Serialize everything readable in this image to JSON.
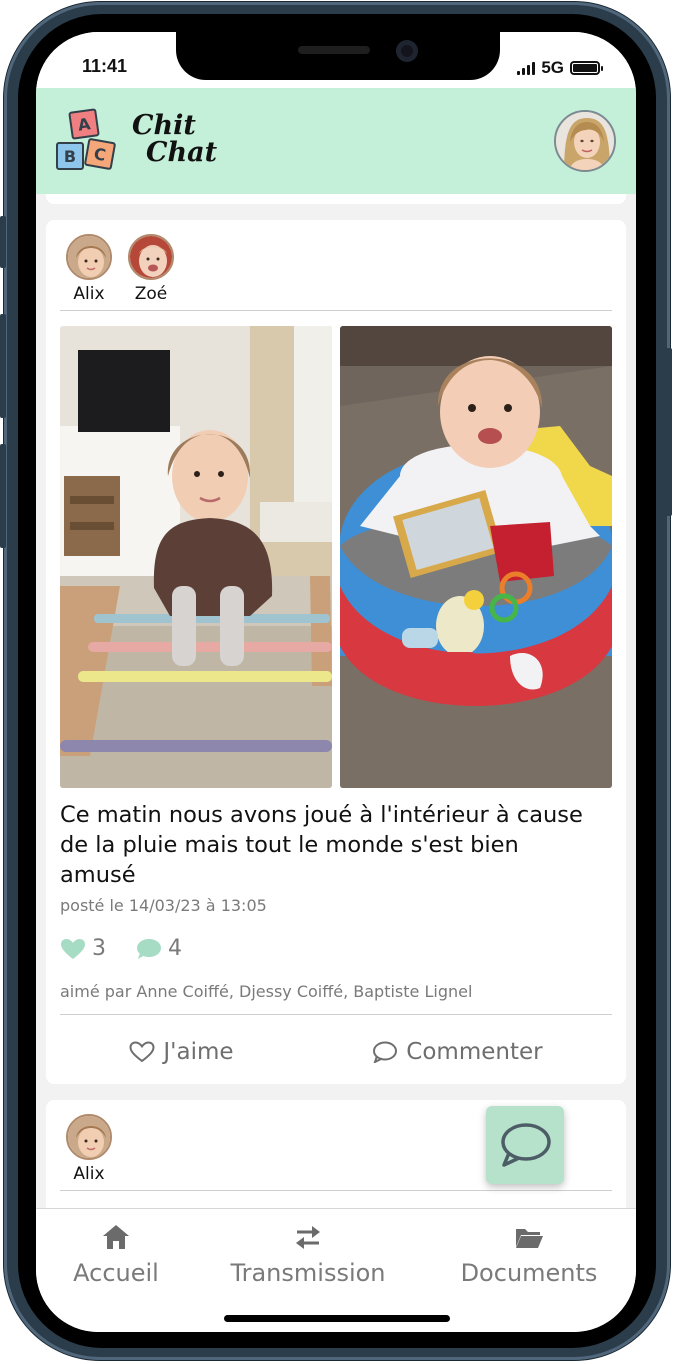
{
  "status_bar": {
    "time": "11:41",
    "network": "5G"
  },
  "header": {
    "logo_blocks": [
      "A",
      "B",
      "C"
    ],
    "logo_text_line1": "Chit",
    "logo_text_line2": "Chat",
    "avatar_icon": "user-avatar"
  },
  "posts": [
    {
      "children": [
        {
          "name": "Alix"
        },
        {
          "name": "Zoé"
        }
      ],
      "text": "Ce matin nous avons joué à l'intérieur à cause de la pluie mais tout le monde s'est bien amusé",
      "date": "posté le 14/03/23 à 13:05",
      "likes": "3",
      "comments": "4",
      "liked_by": "aimé par Anne Coiffé, Djessy Coiffé, Baptiste Lignel",
      "like_label": "J'aime",
      "comment_label": "Commenter"
    },
    {
      "children": [
        {
          "name": "Alix"
        }
      ]
    }
  ],
  "nav": {
    "items": [
      {
        "label": "Accueil",
        "icon": "home-icon"
      },
      {
        "label": "Transmission",
        "icon": "transfer-icon"
      },
      {
        "label": "Documents",
        "icon": "folder-icon"
      }
    ]
  },
  "colors": {
    "header_bg": "#c4efd9",
    "accent": "#a6dcc4",
    "fab_bg": "#b6e2cc",
    "muted_text": "#7a7a7a"
  }
}
